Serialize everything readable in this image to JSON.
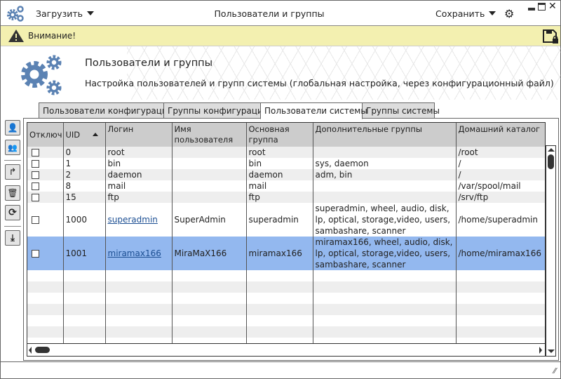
{
  "window": {
    "title": "Пользователи и группы",
    "menu_load": "Загрузить",
    "menu_save": "Сохранить"
  },
  "warning": {
    "text": "Внимание!"
  },
  "header": {
    "title": "Пользователи и группы",
    "subtitle": "Настройка пользователей и групп системы (глобальная настройка, через конфигурационный файл)"
  },
  "tabs": [
    {
      "label": "Пользователи конфигурации"
    },
    {
      "label": "Группы конфигурации"
    },
    {
      "label": "Пользователи системы",
      "active": true
    },
    {
      "label": "Группы системы"
    }
  ],
  "colors": {
    "accent": "#5b82b3",
    "selected_row": "#93b8ef",
    "warning_bg": "#f3f0b0",
    "link": "#1c4f93"
  },
  "table": {
    "columns": [
      "Отключ",
      "UID",
      "Логин",
      "Имя пользователя",
      "Основная группа",
      "Дополнительные группы",
      "Домашний каталог"
    ],
    "sort": {
      "column": "UID",
      "direction": "asc"
    },
    "rows": [
      {
        "disabled": false,
        "uid": "0",
        "login": "root",
        "name": "",
        "group": "root",
        "extra": "",
        "home": "/root"
      },
      {
        "disabled": false,
        "uid": "1",
        "login": "bin",
        "name": "",
        "group": "bin",
        "extra": "sys, daemon",
        "home": "/"
      },
      {
        "disabled": false,
        "uid": "2",
        "login": "daemon",
        "name": "",
        "group": "daemon",
        "extra": "adm, bin",
        "home": "/"
      },
      {
        "disabled": false,
        "uid": "8",
        "login": "mail",
        "name": "",
        "group": "mail",
        "extra": "",
        "home": "/var/spool/mail"
      },
      {
        "disabled": false,
        "uid": "15",
        "login": "ftp",
        "name": "",
        "group": "ftp",
        "extra": "",
        "home": "/srv/ftp"
      },
      {
        "disabled": false,
        "uid": "1000",
        "login": "superadmin",
        "name": "SuperAdmin",
        "group": "superadmin",
        "extra": "superadmin, wheel, audio, disk, lp, optical, storage,video, users, sambashare, scanner",
        "home": "/home/superadmin",
        "link": true
      },
      {
        "disabled": false,
        "uid": "1001",
        "login": "miramax166",
        "name": "MiraMaX166",
        "group": "miramax166",
        "extra": "miramax166, wheel, audio, disk, lp, optical, storage,video, users, sambashare, scanner",
        "home": "/home/miramax166",
        "link": true,
        "selected": true
      }
    ]
  }
}
